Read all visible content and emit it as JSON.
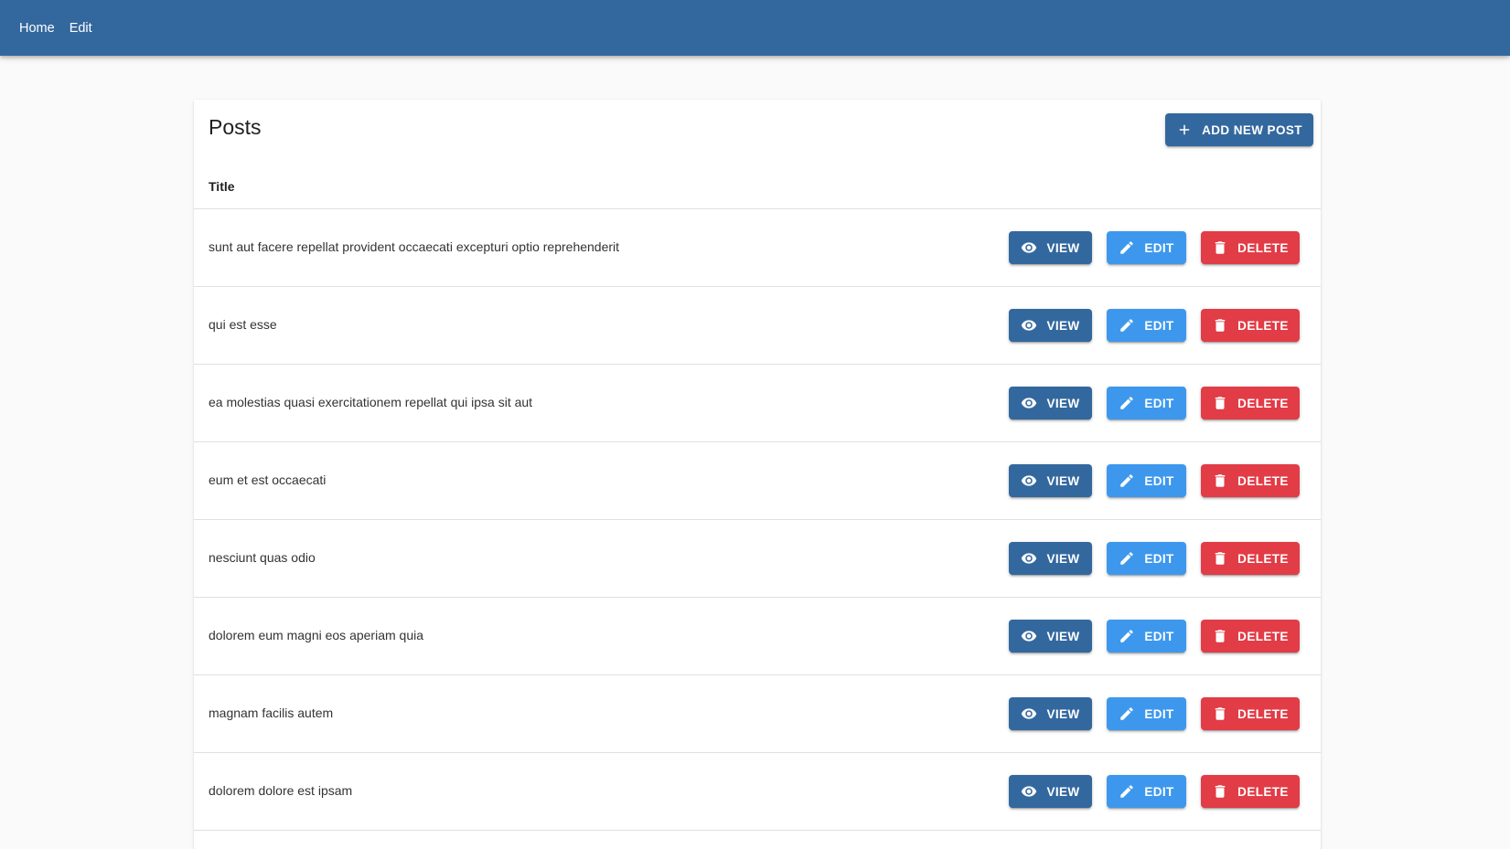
{
  "nav": {
    "items": [
      {
        "label": "Home"
      },
      {
        "label": "Edit"
      }
    ]
  },
  "colors": {
    "appbar": "#33689e",
    "view": "#33689e",
    "edit": "#3d98ed",
    "delete": "#e23c47"
  },
  "page": {
    "title": "Posts",
    "add_button_label": "ADD NEW POST",
    "add_button_icon": "plus-icon"
  },
  "table": {
    "column_title": "Title",
    "action_labels": {
      "view": "VIEW",
      "edit": "EDIT",
      "delete": "DELETE"
    },
    "action_icons": {
      "view": "eye-icon",
      "edit": "pencil-icon",
      "delete": "trash-icon"
    },
    "rows": [
      {
        "title": "sunt aut facere repellat provident occaecati excepturi optio reprehenderit"
      },
      {
        "title": "qui est esse"
      },
      {
        "title": "ea molestias quasi exercitationem repellat qui ipsa sit aut"
      },
      {
        "title": "eum et est occaecati"
      },
      {
        "title": "nesciunt quas odio"
      },
      {
        "title": "dolorem eum magni eos aperiam quia"
      },
      {
        "title": "magnam facilis autem"
      },
      {
        "title": "dolorem dolore est ipsam"
      }
    ]
  }
}
